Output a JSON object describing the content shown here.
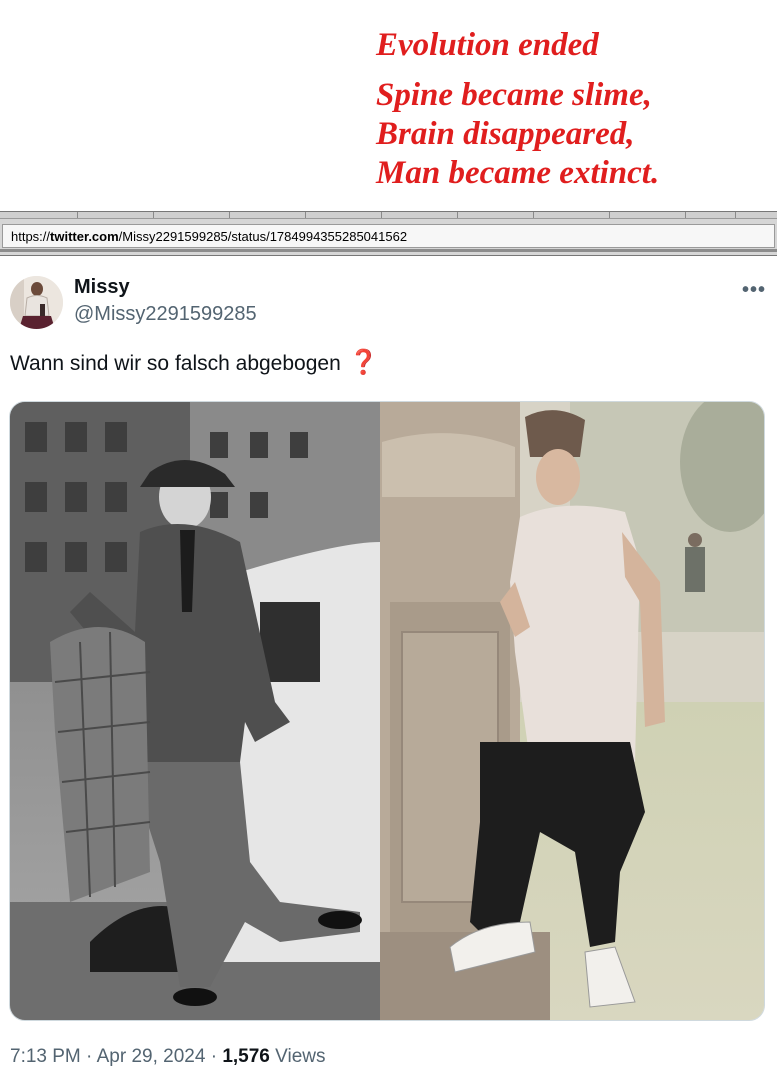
{
  "caption": {
    "line1": "Evolution ended",
    "line2": "Spine became slime,",
    "line3": "Brain disappeared,",
    "line4": "Man became extinct."
  },
  "browser": {
    "url_prefix": "https://",
    "url_domain": "twitter.com",
    "url_path": "/Missy2291599285/status/1784994355285041562"
  },
  "tweet": {
    "display_name": "Missy",
    "handle": "@Missy2291599285",
    "more_icon": "more-horizontal-icon",
    "text": "Wann sind wir so falsch abgebogen",
    "emoji": "❓",
    "time": "7:13 PM",
    "sep1": " · ",
    "date": "Apr 29, 2024",
    "sep2": " · ",
    "views_count": "1,576",
    "views_label": " Views"
  },
  "colors": {
    "caption_red": "#e01e1e",
    "text_primary": "#0f1419",
    "text_secondary": "#536471",
    "border": "#cfd9de"
  }
}
